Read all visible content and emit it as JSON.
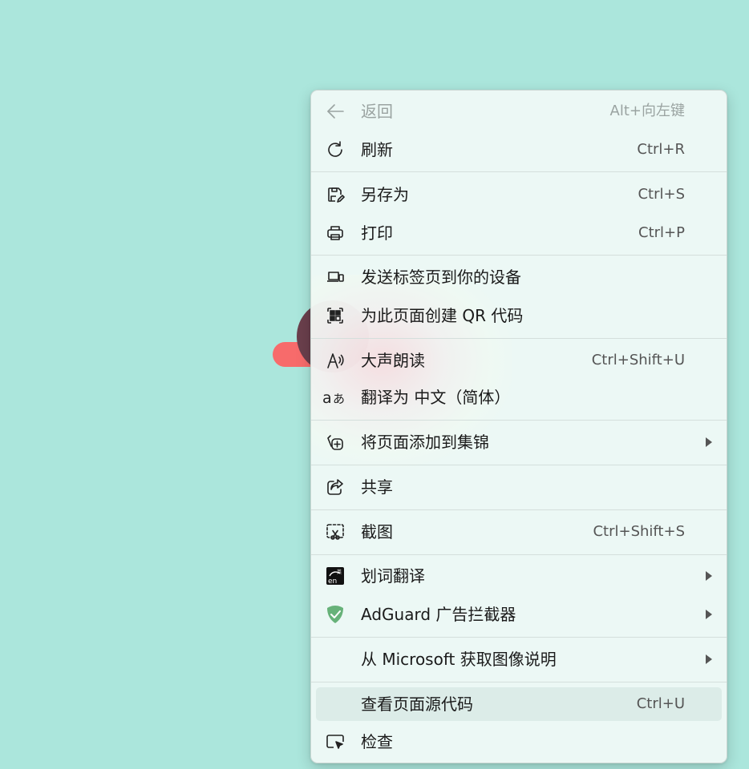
{
  "menu": {
    "items": [
      {
        "label": "返回",
        "shortcut": "Alt+向左键",
        "icon": "back-arrow-icon",
        "disabled": true
      },
      {
        "label": "刷新",
        "shortcut": "Ctrl+R",
        "icon": "refresh-icon"
      },
      {
        "label": "另存为",
        "shortcut": "Ctrl+S",
        "icon": "save-as-icon"
      },
      {
        "label": "打印",
        "shortcut": "Ctrl+P",
        "icon": "printer-icon"
      },
      {
        "label": "发送标签页到你的设备",
        "shortcut": "",
        "icon": "send-tab-to-device-icon"
      },
      {
        "label": "为此页面创建 QR 代码",
        "shortcut": "",
        "icon": "qr-code-icon"
      },
      {
        "label": "大声朗读",
        "shortcut": "Ctrl+Shift+U",
        "icon": "read-aloud-icon"
      },
      {
        "label": "翻译为 中文（简体）",
        "shortcut": "",
        "icon": "translate-icon"
      },
      {
        "label": "将页面添加到集锦",
        "shortcut": "",
        "icon": "collections-add-icon",
        "submenu": true
      },
      {
        "label": "共享",
        "shortcut": "",
        "icon": "share-icon"
      },
      {
        "label": "截图",
        "shortcut": "Ctrl+Shift+S",
        "icon": "screenshot-icon"
      },
      {
        "label": "划词翻译",
        "shortcut": "",
        "icon": "word-translate-extension-icon",
        "submenu": true
      },
      {
        "label": "AdGuard 广告拦截器",
        "shortcut": "",
        "icon": "adguard-shield-icon",
        "submenu": true
      },
      {
        "label": "从 Microsoft 获取图像说明",
        "shortcut": "",
        "icon": "",
        "submenu": true
      },
      {
        "label": "查看页面源代码",
        "shortcut": "Ctrl+U",
        "icon": "",
        "hovered": true
      },
      {
        "label": "检查",
        "shortcut": "",
        "icon": "inspect-icon"
      }
    ]
  },
  "colors": {
    "background": "#abe6dc",
    "menu_background": "#eef9f6",
    "hover": "#dcece8",
    "adguard_green": "#67b279",
    "deco_pink": "#f76b6b",
    "deco_dark": "#6a3f4c"
  }
}
